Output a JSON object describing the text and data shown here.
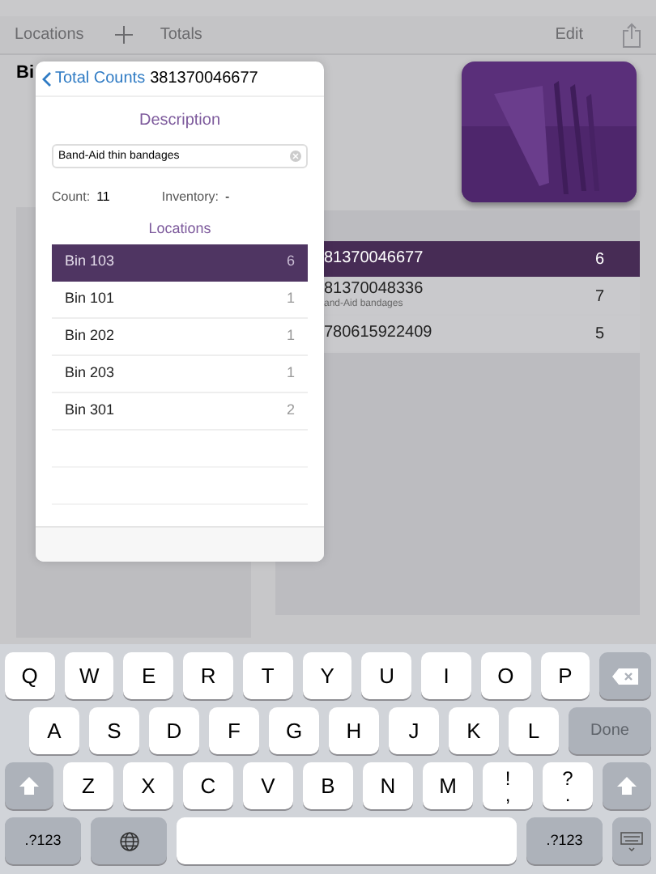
{
  "nav": {
    "locations": "Locations",
    "totals": "Totals",
    "edit": "Edit"
  },
  "background": {
    "title": "Bi",
    "rows": [
      {
        "code": "81370046677",
        "count": "6",
        "selected": true
      },
      {
        "code": "81370048336",
        "subtitle": "and-Aid bandages",
        "count": "7",
        "selected": false
      },
      {
        "code": "780615922409",
        "count": "5",
        "selected": false
      }
    ]
  },
  "popover": {
    "back": "Total Counts",
    "title": "381370046677",
    "description_heading": "Description",
    "description": "Band-Aid thin bandages",
    "count_label": "Count:",
    "count": "11",
    "inventory_label": "Inventory:",
    "inventory": "-",
    "locations_heading": "Locations",
    "locations": [
      {
        "name": "Bin 103",
        "count": "6",
        "selected": true
      },
      {
        "name": "Bin 101",
        "count": "1",
        "selected": false
      },
      {
        "name": "Bin 202",
        "count": "1",
        "selected": false
      },
      {
        "name": "Bin 203",
        "count": "1",
        "selected": false
      },
      {
        "name": "Bin 301",
        "count": "2",
        "selected": false
      }
    ]
  },
  "keyboard": [
    [
      {
        "kind": "letter",
        "label": "Q"
      },
      {
        "kind": "letter",
        "label": "W"
      },
      {
        "kind": "letter",
        "label": "E"
      },
      {
        "kind": "letter",
        "label": "R"
      },
      {
        "kind": "letter",
        "label": "T"
      },
      {
        "kind": "letter",
        "label": "Y"
      },
      {
        "kind": "letter",
        "label": "U"
      },
      {
        "kind": "letter",
        "label": "I"
      },
      {
        "kind": "letter",
        "label": "O"
      },
      {
        "kind": "letter",
        "label": "P"
      },
      {
        "kind": "delete"
      }
    ],
    [
      {
        "kind": "letter",
        "label": "A"
      },
      {
        "kind": "letter",
        "label": "S"
      },
      {
        "kind": "letter",
        "label": "D"
      },
      {
        "kind": "letter",
        "label": "F"
      },
      {
        "kind": "letter",
        "label": "G"
      },
      {
        "kind": "letter",
        "label": "H"
      },
      {
        "kind": "letter",
        "label": "J"
      },
      {
        "kind": "letter",
        "label": "K"
      },
      {
        "kind": "letter",
        "label": "L"
      },
      {
        "kind": "done",
        "label": "Done"
      }
    ],
    [
      {
        "kind": "shift"
      },
      {
        "kind": "letter",
        "label": "Z"
      },
      {
        "kind": "letter",
        "label": "X"
      },
      {
        "kind": "letter",
        "label": "C"
      },
      {
        "kind": "letter",
        "label": "V"
      },
      {
        "kind": "letter",
        "label": "B"
      },
      {
        "kind": "letter",
        "label": "N"
      },
      {
        "kind": "letter",
        "label": "M"
      },
      {
        "kind": "punct",
        "label": "!",
        "sub": ","
      },
      {
        "kind": "punct",
        "label": "?",
        "sub": "."
      },
      {
        "kind": "shift"
      }
    ],
    [
      {
        "kind": "mode",
        "label": ".?123"
      },
      {
        "kind": "globe"
      },
      {
        "kind": "space"
      },
      {
        "kind": "mode",
        "label": ".?123"
      },
      {
        "kind": "hide"
      }
    ]
  ]
}
